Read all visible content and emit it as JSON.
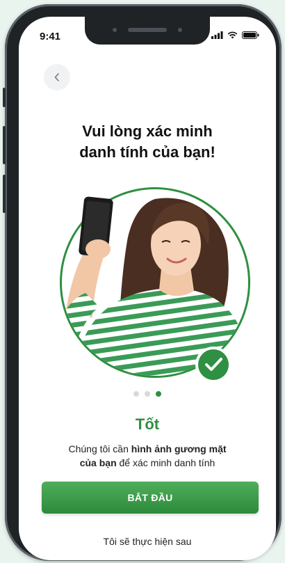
{
  "status_bar": {
    "time": "9:41"
  },
  "header": {
    "back_icon": "chevron-left-icon"
  },
  "title": "Vui lòng xác minh\ndanh tính của bạn!",
  "hero": {
    "image": "woman-taking-selfie",
    "badge_icon": "check-icon"
  },
  "pager": {
    "count": 3,
    "active_index": 2
  },
  "subtitle": "Tốt",
  "description": {
    "part1": "Chúng tôi cần ",
    "bold1": "hình ảnh gương mặt",
    "bold2": "của bạn",
    "part2": " để xác minh danh tính"
  },
  "primary_button": {
    "label": "BẮT ĐẦU"
  },
  "secondary_link": {
    "label": "Tôi sẽ thực hiện sau"
  },
  "colors": {
    "accent": "#2f8f42",
    "background": "#e9f4ee",
    "frame": "#1f2326"
  }
}
